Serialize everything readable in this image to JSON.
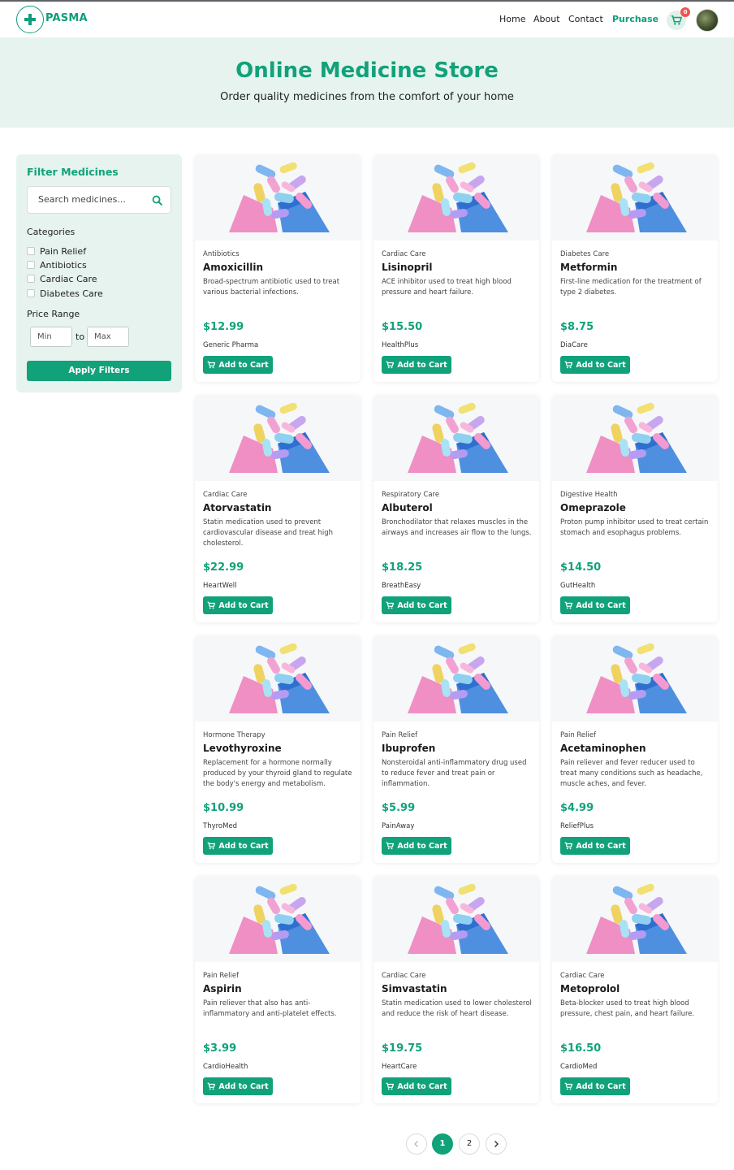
{
  "brand": {
    "name": "PASMA"
  },
  "nav": {
    "home": "Home",
    "about": "About",
    "contact": "Contact",
    "purchase": "Purchase"
  },
  "cart": {
    "count": "0"
  },
  "hero": {
    "title": "Online Medicine Store",
    "subtitle": "Order quality medicines from the comfort of your home"
  },
  "filter": {
    "title": "Filter Medicines",
    "search_placeholder": "Search medicines...",
    "categories_label": "Categories",
    "categories": [
      "Pain Relief",
      "Antibiotics",
      "Cardiac Care",
      "Diabetes Care"
    ],
    "price_label": "Price Range",
    "min_placeholder": "Min",
    "to_label": "to",
    "max_placeholder": "Max",
    "apply_label": "Apply Filters"
  },
  "add_to_cart_label": "Add to Cart",
  "products": [
    {
      "category": "Antibiotics",
      "name": "Amoxicillin",
      "description": "Broad-spectrum antibiotic used to treat various bacterial infections.",
      "price": "$12.99",
      "manufacturer": "Generic Pharma"
    },
    {
      "category": "Cardiac Care",
      "name": "Lisinopril",
      "description": "ACE inhibitor used to treat high blood pressure and heart failure.",
      "price": "$15.50",
      "manufacturer": "HealthPlus"
    },
    {
      "category": "Diabetes Care",
      "name": "Metformin",
      "description": "First-line medication for the treatment of type 2 diabetes.",
      "price": "$8.75",
      "manufacturer": "DiaCare"
    },
    {
      "category": "Cardiac Care",
      "name": "Atorvastatin",
      "description": "Statin medication used to prevent cardiovascular disease and treat high cholesterol.",
      "price": "$22.99",
      "manufacturer": "HeartWell"
    },
    {
      "category": "Respiratory Care",
      "name": "Albuterol",
      "description": "Bronchodilator that relaxes muscles in the airways and increases air flow to the lungs.",
      "price": "$18.25",
      "manufacturer": "BreathEasy"
    },
    {
      "category": "Digestive Health",
      "name": "Omeprazole",
      "description": "Proton pump inhibitor used to treat certain stomach and esophagus problems.",
      "price": "$14.50",
      "manufacturer": "GutHealth"
    },
    {
      "category": "Hormone Therapy",
      "name": "Levothyroxine",
      "description": "Replacement for a hormone normally produced by your thyroid gland to regulate the body's energy and metabolism.",
      "price": "$10.99",
      "manufacturer": "ThyroMed"
    },
    {
      "category": "Pain Relief",
      "name": "Ibuprofen",
      "description": "Nonsteroidal anti-inflammatory drug used to reduce fever and treat pain or inflammation.",
      "price": "$5.99",
      "manufacturer": "PainAway"
    },
    {
      "category": "Pain Relief",
      "name": "Acetaminophen",
      "description": "Pain reliever and fever reducer used to treat many conditions such as headache, muscle aches, and fever.",
      "price": "$4.99",
      "manufacturer": "ReliefPlus"
    },
    {
      "category": "Pain Relief",
      "name": "Aspirin",
      "description": "Pain reliever that also has anti-inflammatory and anti-platelet effects.",
      "price": "$3.99",
      "manufacturer": "CardioHealth"
    },
    {
      "category": "Cardiac Care",
      "name": "Simvastatin",
      "description": "Statin medication used to lower cholesterol and reduce the risk of heart disease.",
      "price": "$19.75",
      "manufacturer": "HeartCare"
    },
    {
      "category": "Cardiac Care",
      "name": "Metoprolol",
      "description": "Beta-blocker used to treat high blood pressure, chest pain, and heart failure.",
      "price": "$16.50",
      "manufacturer": "CardioMed"
    }
  ],
  "pagination": {
    "pages": [
      "1",
      "2"
    ],
    "current": "1"
  },
  "colors": {
    "accent": "#11a27a",
    "hero_bg": "#e6f3ee",
    "badge": "#ef5350"
  },
  "icons": {
    "cart": "cart-icon",
    "search": "search-icon",
    "prev": "chevron-left-icon",
    "next": "chevron-right-icon"
  }
}
